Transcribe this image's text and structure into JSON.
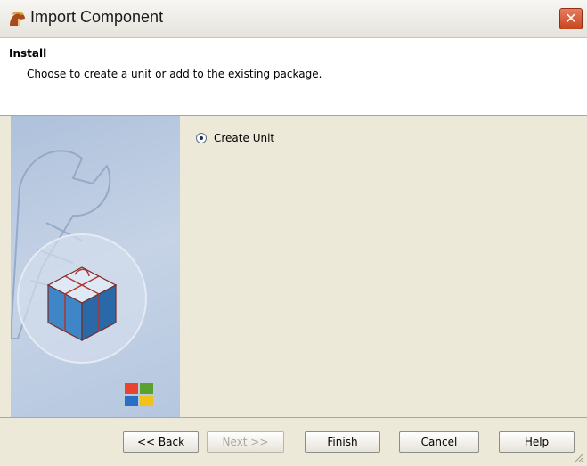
{
  "window": {
    "title": "Import Component",
    "close_glyph": "✕"
  },
  "header": {
    "title": "Install",
    "description": "Choose to create a unit or add to the existing package."
  },
  "options": {
    "create_unit_label": "Create Unit",
    "create_unit_selected": true
  },
  "buttons": {
    "back": "<< Back",
    "next": "Next >>",
    "finish": "Finish",
    "cancel": "Cancel",
    "help": "Help"
  },
  "colors": {
    "accent": "#c8451f",
    "panel": "#b5c7df"
  },
  "icons": {
    "app": "spartan-helmet-icon",
    "wrench": "wrench-icon",
    "package": "package-box-icon",
    "windows_logo": "windows-logo-icon"
  }
}
